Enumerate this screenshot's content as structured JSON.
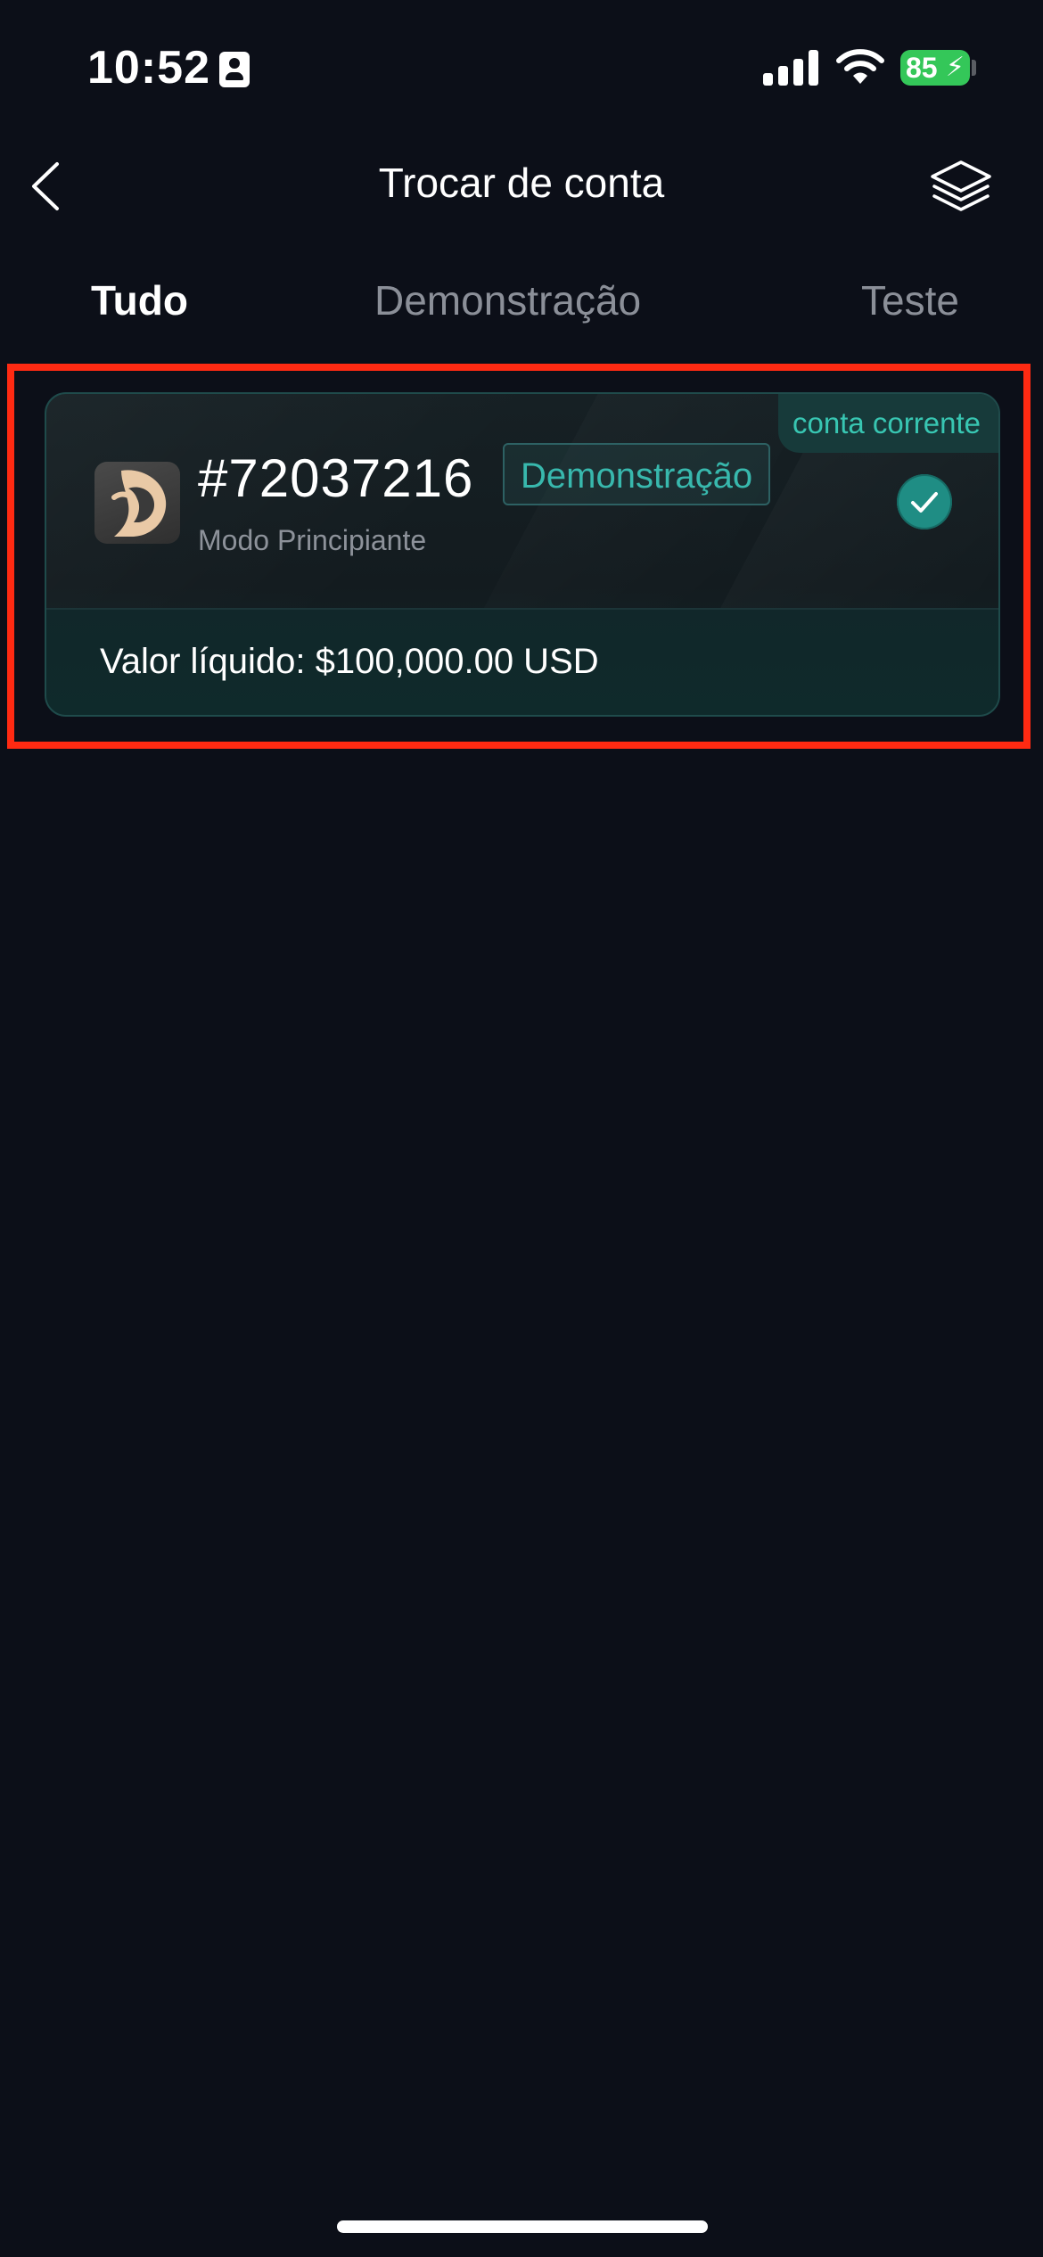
{
  "status_bar": {
    "time": "10:52",
    "battery_level": "85",
    "battery_color": "#34c759",
    "icons": [
      "id-badge-icon",
      "signal-icon",
      "wifi-icon",
      "battery-icon",
      "charging-bolt-icon"
    ]
  },
  "header": {
    "title": "Trocar de conta",
    "back_icon": "chevron-left-icon",
    "layers_icon": "layers-icon"
  },
  "tabs": [
    {
      "label": "Tudo",
      "active": true
    },
    {
      "label": "Demonstração",
      "active": false
    },
    {
      "label": "Teste",
      "active": false
    }
  ],
  "account_card": {
    "badge": "conta corrente",
    "account_number": "#72037216",
    "account_type_tag": "Demonstração",
    "subtitle": "Modo Principiante",
    "net_value": "Valor líquido: $100,000.00 USD",
    "selected": true,
    "accent_color": "#38c6b2",
    "selection_icon": "checkmark-circle-icon",
    "avatar_icon": "brand-logo-icon"
  },
  "colors": {
    "background": "#0c0f18",
    "highlight_frame": "#ff2a12",
    "check_fill": "#1f8d84",
    "inactive_tab_text": "#8b8f98"
  }
}
